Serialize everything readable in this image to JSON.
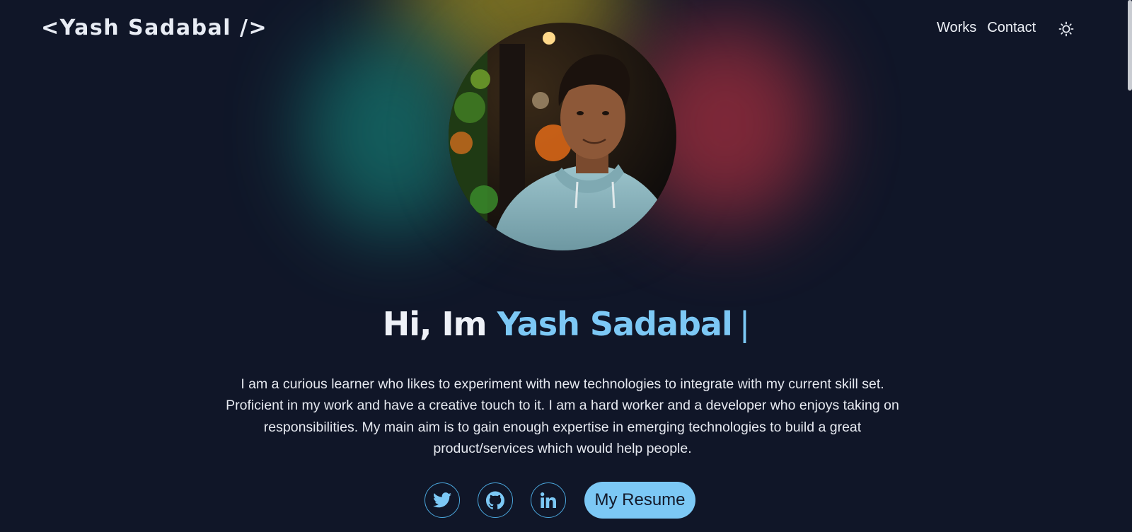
{
  "header": {
    "logo": "<Yash Sadabal />",
    "nav": [
      {
        "label": "Works"
      },
      {
        "label": "Contact"
      }
    ],
    "theme_toggle_icon": "sun-icon"
  },
  "hero": {
    "greeting": "Hi, Im",
    "name": "Yash Sadabal",
    "cursor": "|",
    "avatar_icon": "profile-photo",
    "bio": "I am a curious learner who likes to experiment with new technologies to integrate with my current skill set. Proficient in my work and have a creative touch to it. I am a hard worker and a developer who enjoys taking on responsibilities. My main aim is to gain enough expertise in emerging technologies to build a great product/services which would help people."
  },
  "socials": [
    {
      "icon": "twitter-icon"
    },
    {
      "icon": "github-icon"
    },
    {
      "icon": "linkedin-icon"
    }
  ],
  "resume_button": "My Resume",
  "colors": {
    "background": "#101628",
    "accent": "#7cc8f5",
    "text": "#eef1f7"
  }
}
